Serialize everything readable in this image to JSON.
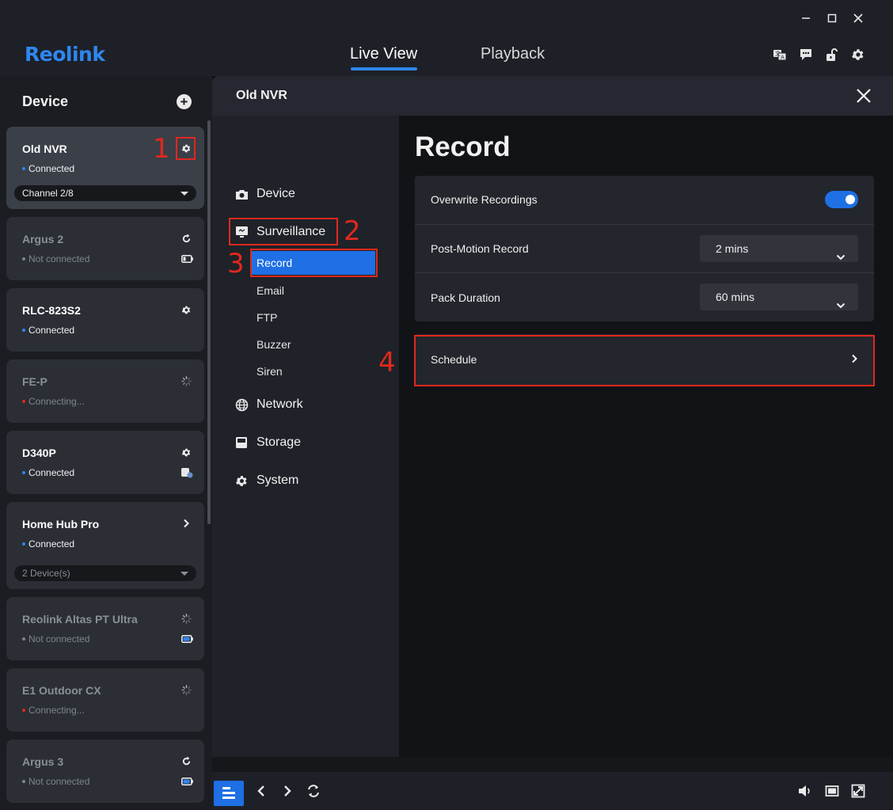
{
  "app": {
    "logo": "Reolink"
  },
  "window_controls": {
    "minimize": "—",
    "maximize": "☐",
    "close": "✕"
  },
  "nav": {
    "tabs": [
      "Live View",
      "Playback"
    ]
  },
  "sidebar": {
    "title": "Device",
    "devices": [
      {
        "name": "Old NVR",
        "status": "Connected",
        "select": "Channel 2/8"
      },
      {
        "name": "Argus 2",
        "status": "Not connected"
      },
      {
        "name": "RLC-823S2",
        "status": "Connected"
      },
      {
        "name": "FE-P",
        "status": "Connecting..."
      },
      {
        "name": "D340P",
        "status": "Connected"
      },
      {
        "name": "Home Hub Pro",
        "status": "Connected",
        "select": "2 Device(s)"
      },
      {
        "name": "Reolink Altas PT Ultra",
        "status": "Not connected"
      },
      {
        "name": "E1 Outdoor CX",
        "status": "Connecting..."
      },
      {
        "name": "Argus 3",
        "status": "Not connected"
      }
    ]
  },
  "dialog": {
    "title": "Old NVR",
    "nav": {
      "device": "Device",
      "surveillance": "Surveillance",
      "sub": [
        "Record",
        "Email",
        "FTP",
        "Buzzer",
        "Siren"
      ],
      "network": "Network",
      "storage": "Storage",
      "system": "System"
    },
    "content": {
      "title": "Record",
      "overwrite_label": "Overwrite Recordings",
      "overwrite_on": true,
      "post_motion_label": "Post-Motion Record",
      "post_motion_value": "2 mins",
      "pack_label": "Pack Duration",
      "pack_value": "60 mins",
      "schedule_label": "Schedule"
    }
  },
  "annotations": [
    "1",
    "2",
    "3",
    "4"
  ],
  "colors": {
    "accent": "#1f6fe5",
    "annotation": "#e0281e",
    "connected": "#2f86f0",
    "warning": "#e0281e"
  }
}
